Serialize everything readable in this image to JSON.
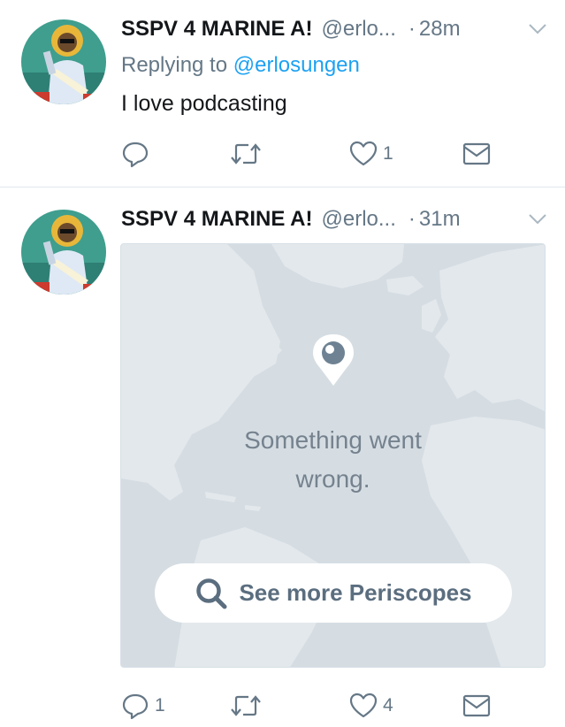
{
  "tweets": [
    {
      "author": "SSPV 4 MARINE A!",
      "handle": "@erlo...",
      "separator": "·",
      "time": "28m",
      "reply_prefix": "Replying to",
      "reply_to": "@erlosungen",
      "text": "I love podcasting",
      "actions": {
        "replies": "",
        "retweets": "",
        "likes": "1"
      }
    },
    {
      "author": "SSPV 4 MARINE A!",
      "handle": "@erlo...",
      "separator": "·",
      "time": "31m",
      "card": {
        "error_line1": "Something went",
        "error_line2": "wrong.",
        "button_label": "See more Periscopes"
      },
      "actions": {
        "replies": "1",
        "retweets": "",
        "likes": "4"
      }
    }
  ],
  "colors": {
    "accent": "#1da1f2",
    "secondary_text": "#657786",
    "map_water": "#d5dde3",
    "map_land": "#e3e8ec"
  },
  "icons": [
    "avatar-icon",
    "chevron-down-icon",
    "reply-icon",
    "retweet-icon",
    "heart-icon",
    "envelope-icon",
    "periscope-pin-icon",
    "search-icon"
  ]
}
